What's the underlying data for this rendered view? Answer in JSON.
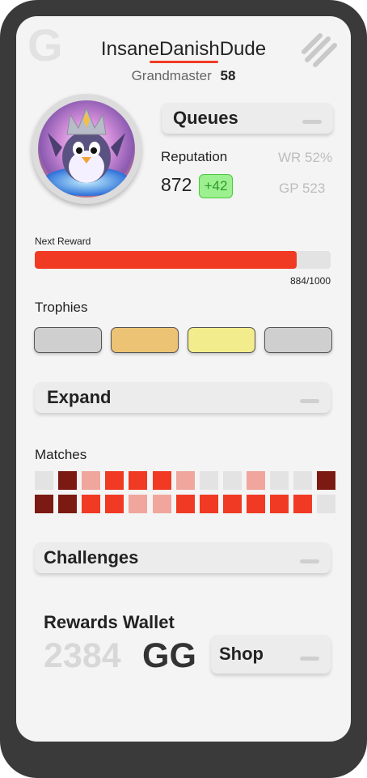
{
  "colors": {
    "accent": "#f03a24",
    "positive": "#9cf08f",
    "muted": "#bdbdbd"
  },
  "header": {
    "logo_letter": "G",
    "username": "InsaneDanishDude",
    "rank_name": "Grandmaster",
    "rank_level": "58",
    "menu_icon": "hamburger-slash-icon"
  },
  "avatar": {
    "icon": "penguin-avatar"
  },
  "queues_button": {
    "label": "Queues"
  },
  "stats": {
    "reputation_label": "Reputation",
    "reputation_value": "872",
    "reputation_delta": "+42",
    "winrate": "WR 52%",
    "games_played": "GP 523"
  },
  "next_reward": {
    "label": "Next Reward",
    "current": 884,
    "max": 1000,
    "progress_text": "884/1000"
  },
  "trophies": {
    "label": "Trophies",
    "items": [
      {
        "name": "trophy-silver",
        "color": "#cfcfcf"
      },
      {
        "name": "trophy-bronze",
        "color": "#ecc274"
      },
      {
        "name": "trophy-gold",
        "color": "#f3ec8d"
      },
      {
        "name": "trophy-silver-2",
        "color": "#cfcfcf"
      }
    ]
  },
  "expand_button": {
    "label": "Expand"
  },
  "matches": {
    "label": "Matches",
    "rows": [
      [
        "empty",
        "dark",
        "light",
        "red",
        "red",
        "red",
        "light",
        "empty",
        "empty",
        "light",
        "empty",
        "empty",
        "dark"
      ],
      [
        "dark",
        "dark",
        "red",
        "red",
        "light",
        "light",
        "red",
        "red",
        "red",
        "red",
        "red",
        "red",
        "empty"
      ]
    ],
    "palette": {
      "empty": "#e3e3e3",
      "dark": "#7a1a12",
      "red": "#f03a24",
      "light": "#f0a69c"
    }
  },
  "challenges_button": {
    "label": "Challenges"
  },
  "wallet": {
    "label": "Rewards Wallet",
    "amount": "2384",
    "unit": "GG"
  },
  "shop_button": {
    "label": "Shop"
  }
}
